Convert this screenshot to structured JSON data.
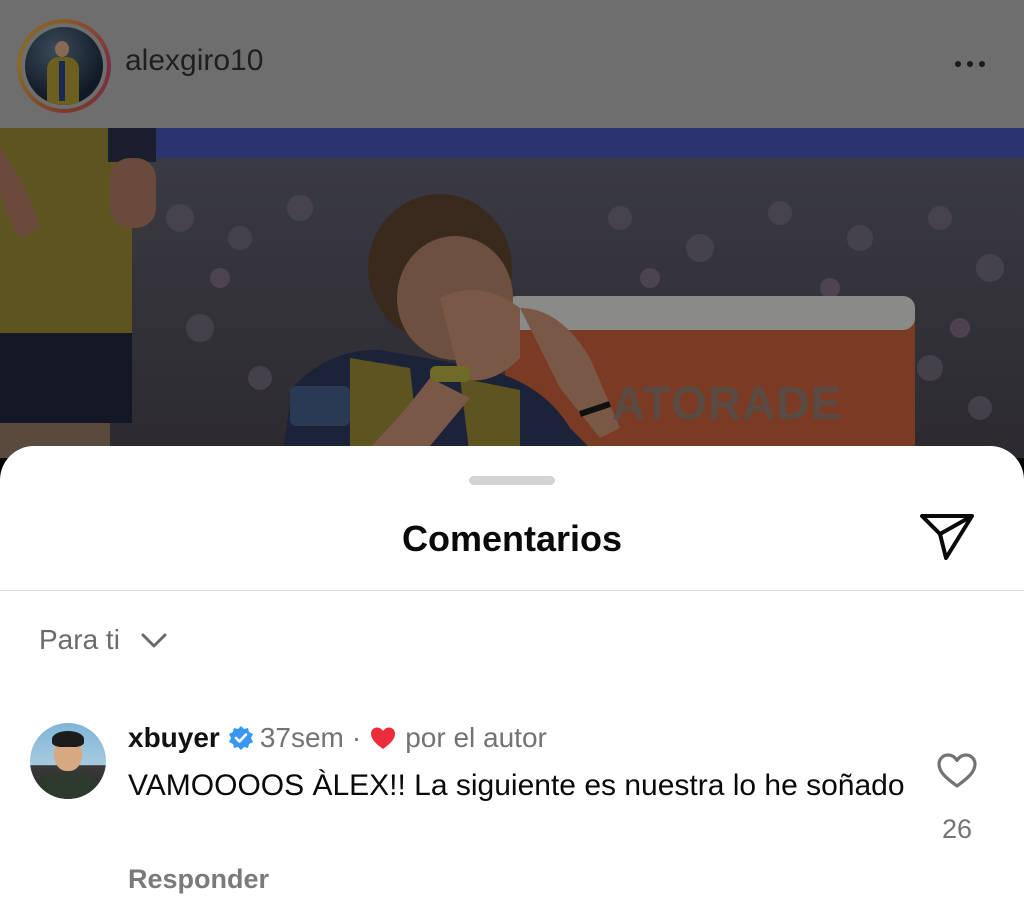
{
  "post": {
    "username": "alexgiro10",
    "more_icon": "more-horizontal-icon",
    "photo_text": "ATORADE"
  },
  "sheet": {
    "title": "Comentarios",
    "share_icon": "send-icon"
  },
  "filter": {
    "label": "Para ti",
    "icon": "chevron-down-icon"
  },
  "comment": {
    "username": "xbuyer",
    "verified_icon": "verified-badge-icon",
    "time": "37sem",
    "separator": "·",
    "author_like_icon": "red-heart-icon",
    "author_like_text": "por el autor",
    "text": "VAMOOOOS ÀLEX!! La siguiente es nuestra lo he soñado",
    "reply_label": "Responder",
    "like_icon": "heart-outline-icon",
    "like_count": "26"
  },
  "colors": {
    "verified": "#3897f0",
    "author_heart": "#ed2c3b",
    "secondary_text": "#737373"
  }
}
